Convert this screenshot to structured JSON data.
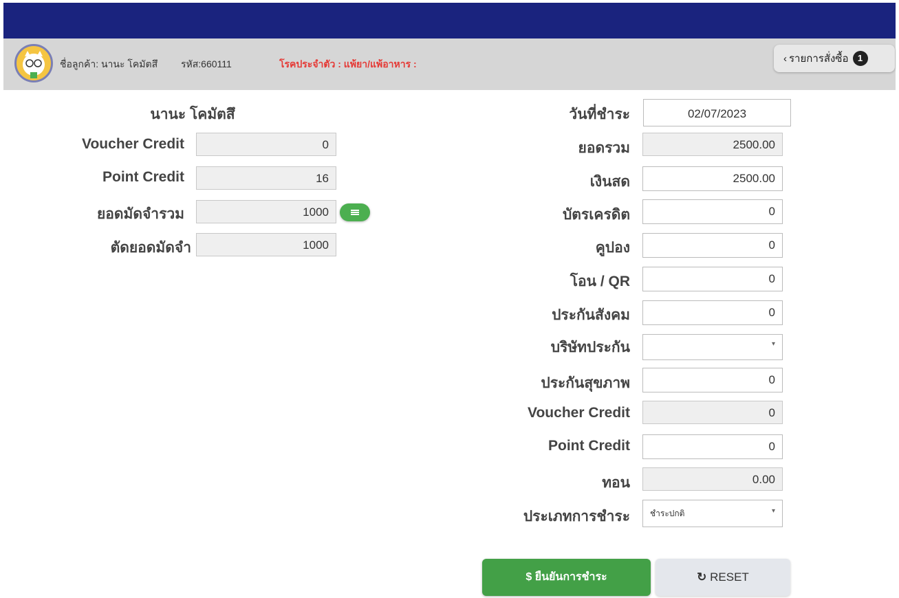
{
  "header": {
    "customer_label": "ชื่อลูกค้า: นานะ โคมัตสึ",
    "code_label": "รหัส:660111",
    "disease_label": "โรคประจำตัว :  แพ้ยา/แพ้อาหาร :",
    "order_button": "รายการสั่งซื้อ",
    "order_count": "1"
  },
  "left": {
    "customer_name": "นานะ โคมัตสึ",
    "voucher_label": "Voucher Credit",
    "voucher_value": "0",
    "point_label": "Point Credit",
    "point_value": "16",
    "deposit_total_label": "ยอดมัดจำรวม",
    "deposit_total_value": "1000",
    "deposit_cut_label": "ตัดยอดมัดจำ",
    "deposit_cut_value": "1000"
  },
  "right": {
    "date_label": "วันที่ชำระ",
    "date_value": "02/07/2023",
    "total_label": "ยอดรวม",
    "total_value": "2500.00",
    "cash_label": "เงินสด",
    "cash_value": "2500.00",
    "credit_card_label": "บัตรเครดิต",
    "credit_card_value": "0",
    "coupon_label": "คูปอง",
    "coupon_value": "0",
    "transfer_label": "โอน / QR",
    "transfer_value": "0",
    "social_security_label": "ประกันสังคม",
    "social_security_value": "0",
    "insurance_company_label": "บริษัทประกัน",
    "insurance_company_value": "",
    "health_insurance_label": "ประกันสุขภาพ",
    "health_insurance_value": "0",
    "voucher_label": "Voucher Credit",
    "voucher_value": "0",
    "point_label": "Point Credit",
    "point_value": "0",
    "change_label": "ทอน",
    "change_value": "0.00",
    "payment_type_label": "ประเภทการชำระ",
    "payment_type_value": "ชำระปกติ"
  },
  "actions": {
    "confirm": "$ ยืนยันการชำระ",
    "reset": "RESET"
  },
  "colors": {
    "topbar": "#1a237e",
    "confirm": "#43a047",
    "disease_text": "#e53935"
  }
}
